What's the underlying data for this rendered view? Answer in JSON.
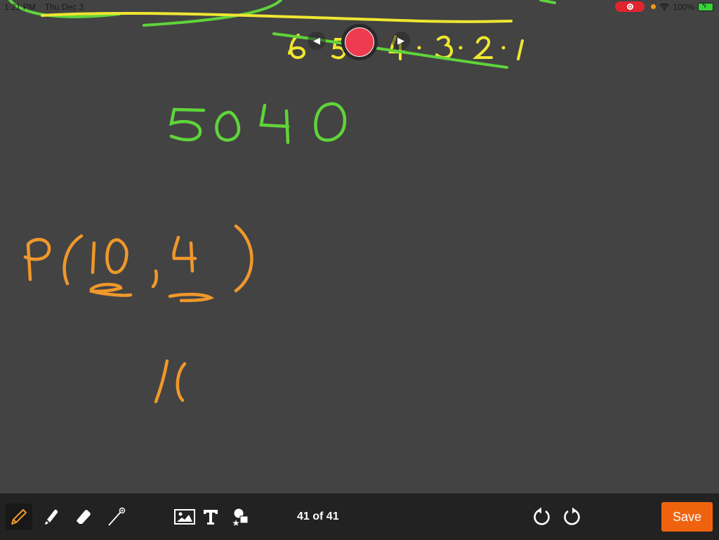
{
  "status_bar": {
    "time": "1:21 PM",
    "date": "Thu Dec 3",
    "battery": "100%"
  },
  "recording": {
    "prev_glyph": "◀",
    "next_glyph": "▶"
  },
  "whiteboard": {
    "strokes": [
      {
        "text": "6·5·4·3·2·1",
        "color": "#f0e630",
        "note": "factorial product with green strike-through"
      },
      {
        "text": "5040",
        "color": "#5fd43a"
      },
      {
        "text": "P(10, 4)",
        "color": "#f0982a"
      },
      {
        "text": "1(",
        "color": "#f0982a"
      }
    ]
  },
  "toolbar": {
    "tools": [
      "pen",
      "highlighter",
      "eraser",
      "laser-pointer"
    ],
    "insert": [
      "image",
      "text",
      "shapes"
    ],
    "page_counter": "41 of 41",
    "save_label": "Save"
  },
  "colors": {
    "background": "#434343",
    "toolbar": "#222222",
    "save": "#f0630e",
    "record": "#ef3b4f"
  }
}
